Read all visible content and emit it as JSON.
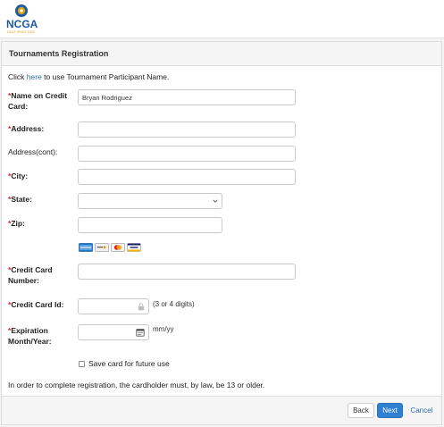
{
  "logo": {
    "name": "NCGA",
    "tagline": "GOLF SINCE 1903"
  },
  "page": {
    "title": "Tournaments Registration",
    "intro_prefix": "Click ",
    "intro_link": "here",
    "intro_suffix": " to use Tournament Participant Name."
  },
  "form": {
    "name_on_card": {
      "label": "Name on Credit Card:",
      "value": "Bryan Rodriguez"
    },
    "address": {
      "label": "Address:",
      "value": ""
    },
    "address_cont": {
      "label": "Address(cont):",
      "value": ""
    },
    "city": {
      "label": "City:",
      "value": ""
    },
    "state": {
      "label": "State:",
      "value": ""
    },
    "zip": {
      "label": "Zip:",
      "value": ""
    },
    "card_brands": [
      "AMEX",
      "DISCOVER",
      "MASTERCARD",
      "VISA"
    ],
    "card_number": {
      "label": "Credit Card Number:",
      "value": ""
    },
    "card_id": {
      "label": "Credit Card Id:",
      "value": "",
      "hint": "(3 or 4 digits)"
    },
    "expiration": {
      "label": "Expiration Month/Year:",
      "value": "",
      "hint": "mm/yy"
    },
    "save_card": {
      "label": "Save card for future use",
      "checked": false
    },
    "required_marker": "*"
  },
  "notice": "In order to complete registration, the cardholder must, by law, be 13 or older.",
  "buttons": {
    "back": "Back",
    "next": "Next",
    "cancel": "Cancel"
  },
  "colors": {
    "required": "#dd2222",
    "link": "#2a6fb0",
    "primary": "#2f80d1",
    "logo_blue": "#1c5aa6",
    "logo_gold": "#d7a21b"
  },
  "icons": {
    "card_id_field": "lock-icon",
    "expiration_field": "calendar-icon",
    "state_select": "chevron-down-icon"
  }
}
